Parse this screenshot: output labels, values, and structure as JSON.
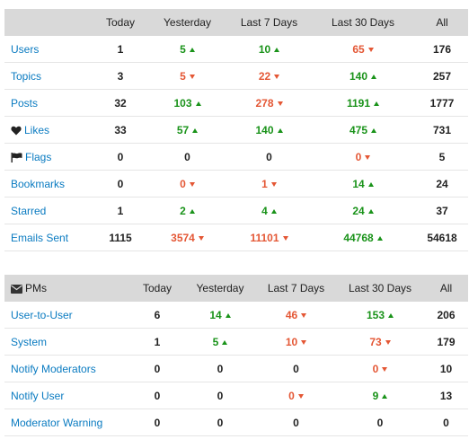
{
  "colors": {
    "header_bg": "#d9d9d9",
    "link_blue": "#0a7bc1",
    "up_green": "#1a931a",
    "down_red": "#e45735",
    "row_border": "#e5e5e5"
  },
  "site_stats": {
    "columns": [
      "",
      "Today",
      "Yesterday",
      "Last 7 Days",
      "Last 30 Days",
      "All"
    ],
    "rows": [
      {
        "label": "Users",
        "icon": null,
        "today": "1",
        "yesterday": {
          "value": "5",
          "trend": "up"
        },
        "last7": {
          "value": "10",
          "trend": "up"
        },
        "last30": {
          "value": "65",
          "trend": "down"
        },
        "all": "176"
      },
      {
        "label": "Topics",
        "icon": null,
        "today": "3",
        "yesterday": {
          "value": "5",
          "trend": "down"
        },
        "last7": {
          "value": "22",
          "trend": "down"
        },
        "last30": {
          "value": "140",
          "trend": "up"
        },
        "all": "257"
      },
      {
        "label": "Posts",
        "icon": null,
        "today": "32",
        "yesterday": {
          "value": "103",
          "trend": "up"
        },
        "last7": {
          "value": "278",
          "trend": "down"
        },
        "last30": {
          "value": "1191",
          "trend": "up"
        },
        "all": "1777"
      },
      {
        "label": "Likes",
        "icon": "heart-icon",
        "today": "33",
        "yesterday": {
          "value": "57",
          "trend": "up"
        },
        "last7": {
          "value": "140",
          "trend": "up"
        },
        "last30": {
          "value": "475",
          "trend": "up"
        },
        "all": "731"
      },
      {
        "label": "Flags",
        "icon": "flag-icon",
        "today": "0",
        "yesterday": {
          "value": "0",
          "trend": "none"
        },
        "last7": {
          "value": "0",
          "trend": "none"
        },
        "last30": {
          "value": "0",
          "trend": "down"
        },
        "all": "5"
      },
      {
        "label": "Bookmarks",
        "icon": null,
        "today": "0",
        "yesterday": {
          "value": "0",
          "trend": "down"
        },
        "last7": {
          "value": "1",
          "trend": "down"
        },
        "last30": {
          "value": "14",
          "trend": "up"
        },
        "all": "24"
      },
      {
        "label": "Starred",
        "icon": null,
        "today": "1",
        "yesterday": {
          "value": "2",
          "trend": "up"
        },
        "last7": {
          "value": "4",
          "trend": "up"
        },
        "last30": {
          "value": "24",
          "trend": "up"
        },
        "all": "37"
      },
      {
        "label": "Emails Sent",
        "icon": null,
        "today": "1115",
        "yesterday": {
          "value": "3574",
          "trend": "down"
        },
        "last7": {
          "value": "11101",
          "trend": "down"
        },
        "last30": {
          "value": "44768",
          "trend": "up"
        },
        "all": "54618"
      }
    ]
  },
  "pm_stats": {
    "columns": [
      "PMs",
      "Today",
      "Yesterday",
      "Last 7 Days",
      "Last 30 Days",
      "All"
    ],
    "header_icon": "envelope-icon",
    "rows": [
      {
        "label": "User-to-User",
        "today": "6",
        "yesterday": {
          "value": "14",
          "trend": "up"
        },
        "last7": {
          "value": "46",
          "trend": "down"
        },
        "last30": {
          "value": "153",
          "trend": "up"
        },
        "all": "206"
      },
      {
        "label": "System",
        "today": "1",
        "yesterday": {
          "value": "5",
          "trend": "up"
        },
        "last7": {
          "value": "10",
          "trend": "down"
        },
        "last30": {
          "value": "73",
          "trend": "down"
        },
        "all": "179"
      },
      {
        "label": "Notify Moderators",
        "today": "0",
        "yesterday": {
          "value": "0",
          "trend": "none"
        },
        "last7": {
          "value": "0",
          "trend": "none"
        },
        "last30": {
          "value": "0",
          "trend": "down"
        },
        "all": "10"
      },
      {
        "label": "Notify User",
        "today": "0",
        "yesterday": {
          "value": "0",
          "trend": "none"
        },
        "last7": {
          "value": "0",
          "trend": "down"
        },
        "last30": {
          "value": "9",
          "trend": "up"
        },
        "all": "13"
      },
      {
        "label": "Moderator Warning",
        "today": "0",
        "yesterday": {
          "value": "0",
          "trend": "none"
        },
        "last7": {
          "value": "0",
          "trend": "none"
        },
        "last30": {
          "value": "0",
          "trend": "none"
        },
        "all": "0"
      }
    ]
  }
}
